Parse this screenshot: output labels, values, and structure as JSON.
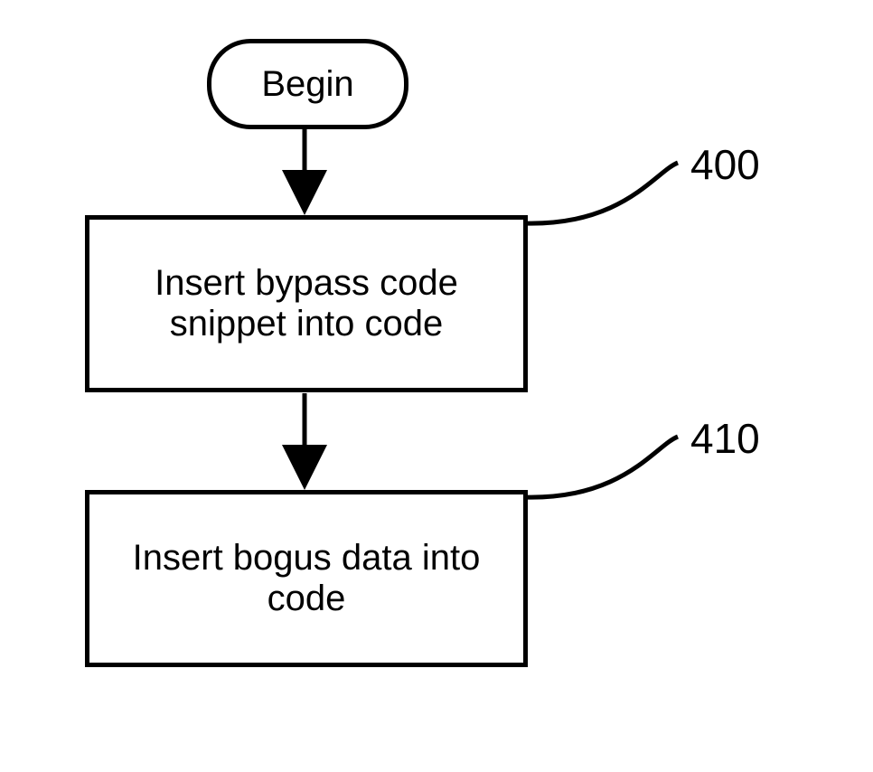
{
  "flowchart": {
    "begin": "Begin",
    "step400": {
      "text_line1": "Insert bypass code",
      "text_line2": "snippet into code",
      "ref": "400"
    },
    "step410": {
      "text_line1": "Insert bogus data into",
      "text_line2": "code",
      "ref": "410"
    }
  }
}
